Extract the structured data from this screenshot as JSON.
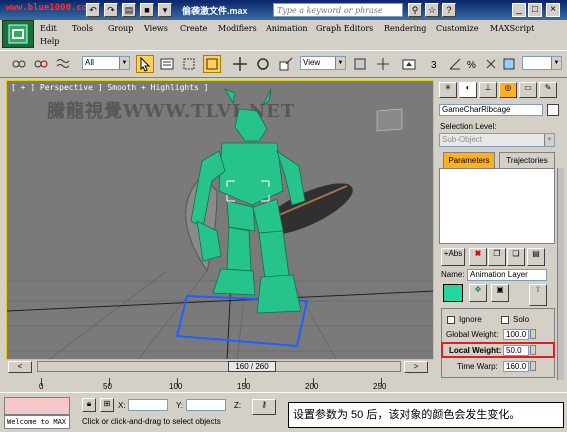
{
  "window": {
    "url_watermark": "www.blue1000.com",
    "filename": "偷袭激文件.max",
    "search_placeholder": "Type a keyword or phrase",
    "help_icon": "help-icon",
    "minimize": "_",
    "maximize": "□",
    "close": "×"
  },
  "menu": {
    "items": [
      "Edit",
      "Tools",
      "Group",
      "Views",
      "Create",
      "Modifiers",
      "Animation",
      "Graph Editors",
      "Rendering",
      "Customize",
      "MAXScript",
      "Help"
    ]
  },
  "toolbar": {
    "selection_filter": "All",
    "ref_coord": "View"
  },
  "viewport": {
    "label": "[ + ] Perspective ] Smooth + Highlights ]",
    "watermark": "騰龍視覺WWW.TLVI.NET"
  },
  "command_panel": {
    "object_name": "GameCharRibcage",
    "selection_level_label": "Selection Level:",
    "selection_level_value": "Sub-Object",
    "tab_parameters": "Parameters",
    "tab_trajectories": "Trajectories",
    "name_label": "Name:",
    "name_value": "Animation Layer",
    "ignore_label": "Ignore",
    "solo_label": "Solo",
    "global_weight_label": "Global Weight:",
    "global_weight_value": "100.0",
    "local_weight_label": "Local Weight:",
    "local_weight_value": "50.0",
    "time_warp_label": "Time Warp:",
    "time_warp_value": "160.0",
    "highlight_color": "#e02020",
    "swatch_color": "#22d8a0"
  },
  "timeline": {
    "slider_label": "160 / 260",
    "ticks": [
      "0",
      "50",
      "100",
      "150",
      "200",
      "250"
    ]
  },
  "status": {
    "welcome": "Welcome to MAX",
    "x_label": "X:",
    "y_label": "Y:",
    "z_label": "Z:",
    "hint": "Click or click-and-drag to select objects"
  },
  "caption": "设置参数为 50 后，该对象的颜色会发生变化。"
}
